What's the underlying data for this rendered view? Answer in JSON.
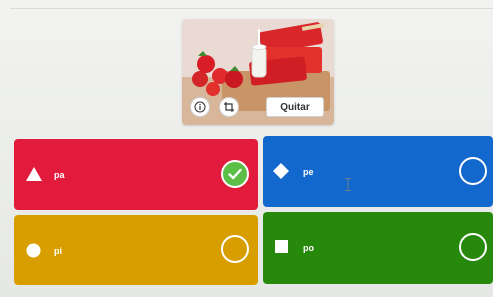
{
  "image": {
    "alt": "Red popsicles with a glass of milk on a wooden board",
    "quit_button_label": "Quitar",
    "info_icon": "info-icon",
    "crop_icon": "crop-icon"
  },
  "answers": [
    {
      "label": "pa",
      "color": "#e21b3c",
      "shape": "triangle",
      "selected": true
    },
    {
      "label": "pe",
      "color": "#1368ce",
      "shape": "diamond",
      "selected": false
    },
    {
      "label": "pi",
      "color": "#d89e00",
      "shape": "circle",
      "selected": false
    },
    {
      "label": "po",
      "color": "#26890c",
      "shape": "square",
      "selected": false
    }
  ]
}
